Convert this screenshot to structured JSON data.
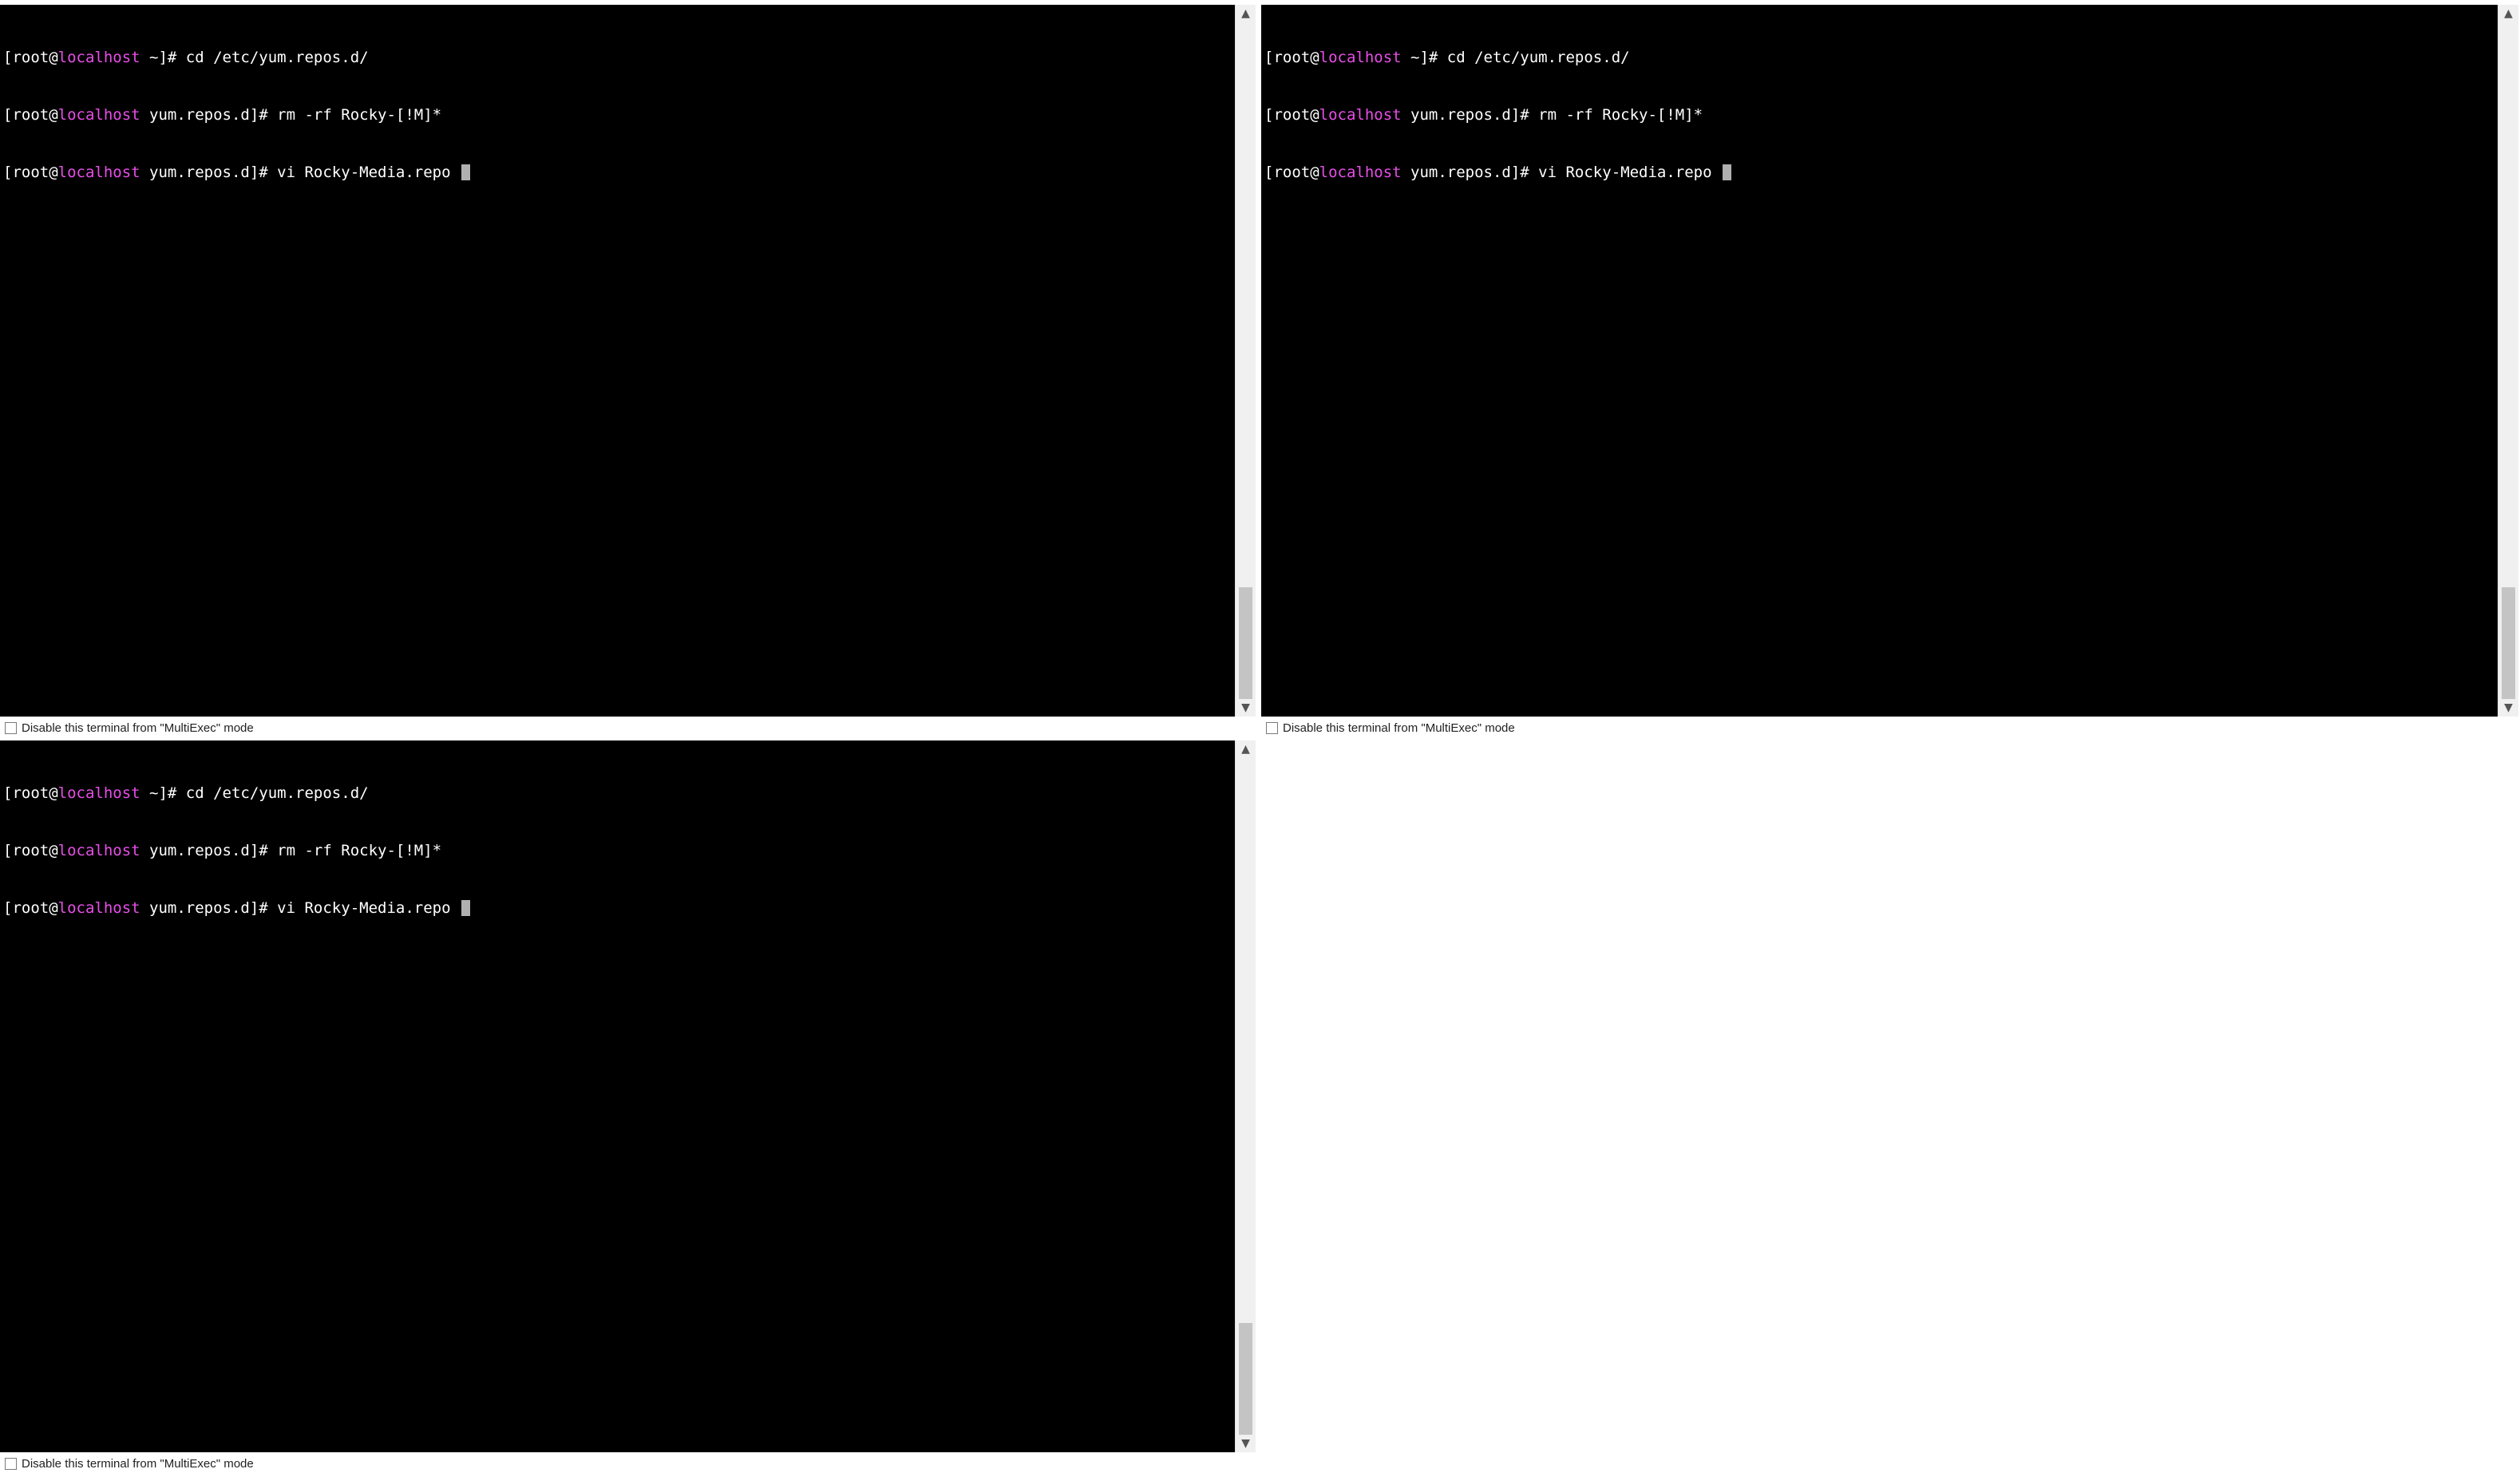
{
  "terminals": [
    {
      "lines": [
        {
          "pre": "[root@",
          "host": "localhost",
          "post": " ~]# cd /etc/yum.repos.d/"
        },
        {
          "pre": "[root@",
          "host": "localhost",
          "post": " yum.repos.d]# rm -rf Rocky-[!M]*"
        },
        {
          "pre": "[root@",
          "host": "localhost",
          "post": " yum.repos.d]# vi Rocky-Media.repo "
        }
      ],
      "multiexec_label": "Disable this terminal from \"MultiExec\" mode"
    },
    {
      "lines": [
        {
          "pre": "[root@",
          "host": "localhost",
          "post": " ~]# cd /etc/yum.repos.d/"
        },
        {
          "pre": "[root@",
          "host": "localhost",
          "post": " yum.repos.d]# rm -rf Rocky-[!M]*"
        },
        {
          "pre": "[root@",
          "host": "localhost",
          "post": " yum.repos.d]# vi Rocky-Media.repo "
        }
      ],
      "multiexec_label": "Disable this terminal from \"MultiExec\" mode"
    },
    {
      "lines": [
        {
          "pre": "[root@",
          "host": "localhost",
          "post": " ~]# cd /etc/yum.repos.d/"
        },
        {
          "pre": "[root@",
          "host": "localhost",
          "post": " yum.repos.d]# rm -rf Rocky-[!M]*"
        },
        {
          "pre": "[root@",
          "host": "localhost",
          "post": " yum.repos.d]# vi Rocky-Media.repo "
        }
      ],
      "multiexec_label": "Disable this terminal from \"MultiExec\" mode"
    }
  ],
  "icons": {
    "scroll_up": "▲",
    "scroll_down": "▼"
  },
  "colors": {
    "terminal_bg": "#000000",
    "text": "#ffffff",
    "hostname": "#e84ee8",
    "cursor": "#b0b0b0"
  }
}
